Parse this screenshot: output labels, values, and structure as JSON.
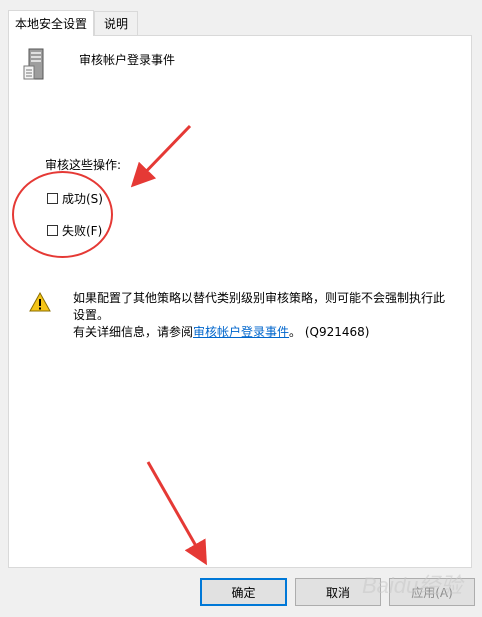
{
  "tabs": [
    {
      "label": "本地安全设置",
      "active": true
    },
    {
      "label": "说明",
      "active": false
    }
  ],
  "policy": {
    "title": "审核帐户登录事件",
    "icon": "server-policy-icon"
  },
  "audit": {
    "label": "审核这些操作:",
    "options": [
      {
        "label": "成功(S)",
        "checked": false
      },
      {
        "label": "失败(F)",
        "checked": false
      }
    ]
  },
  "warning": {
    "icon": "warning-icon",
    "line1": "如果配置了其他策略以替代类别级别审核策略，则可能不会强制执行此设置。",
    "line2_prefix": "有关详细信息，请参阅",
    "link": "审核帐户登录事件",
    "line2_suffix": "。 (Q921468)"
  },
  "buttons": {
    "ok": "确定",
    "cancel": "取消",
    "apply": "应用(A)"
  },
  "watermark": "Baidu经验",
  "colors": {
    "annotation": "#e53935",
    "link": "#0066cc",
    "ok_border": "#0078d7"
  }
}
